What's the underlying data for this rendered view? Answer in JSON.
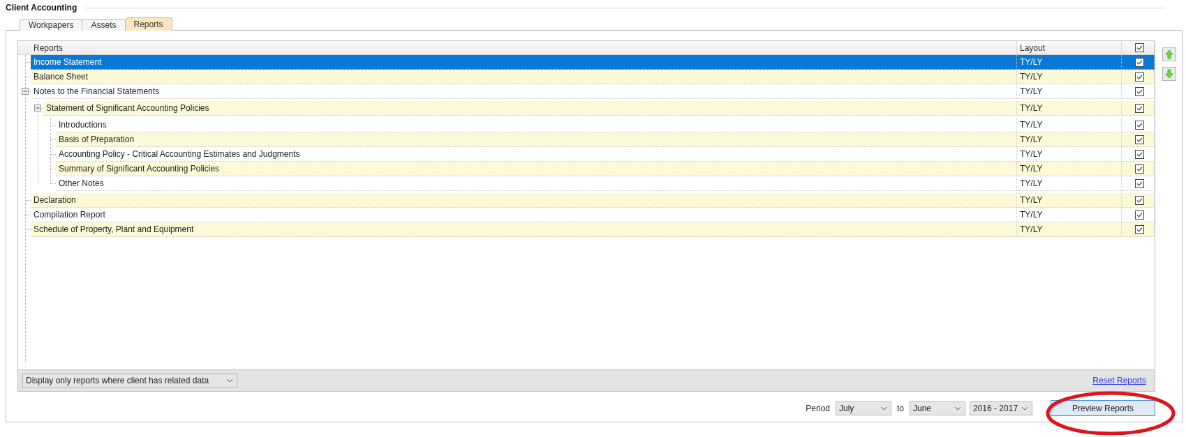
{
  "window": {
    "title": "Client Accounting"
  },
  "tabs": [
    {
      "label": "Workpapers",
      "selected": false
    },
    {
      "label": "Assets",
      "selected": false
    },
    {
      "label": "Reports",
      "selected": true
    }
  ],
  "grid": {
    "columns": [
      "Reports",
      "Layout"
    ],
    "header_checked": true,
    "rows": [
      {
        "label": "Income Statement",
        "layout": "TY/LY",
        "checked": true,
        "selected": true
      },
      {
        "label": "Balance Sheet",
        "layout": "TY/LY",
        "checked": true,
        "selected": false
      },
      {
        "label": "Notes to the Financial Statements",
        "layout": "TY/LY",
        "checked": true,
        "selected": false,
        "expanded": true,
        "children": [
          {
            "label": "Statement of Significant Accounting Policies",
            "layout": "TY/LY",
            "checked": true,
            "selected": false,
            "expanded": true,
            "children": [
              {
                "label": "Introductions",
                "layout": "TY/LY",
                "checked": true,
                "selected": false
              },
              {
                "label": "Basis of Preparation",
                "layout": "TY/LY",
                "checked": true,
                "selected": false
              },
              {
                "label": "Accounting Policy - Critical Accounting Estimates and Judgments",
                "layout": "TY/LY",
                "checked": true,
                "selected": false
              },
              {
                "label": "Summary of Significant Accounting Policies",
                "layout": "TY/LY",
                "checked": true,
                "selected": false
              },
              {
                "label": "Other Notes",
                "layout": "TY/LY",
                "checked": true,
                "selected": false
              }
            ]
          }
        ]
      },
      {
        "label": "Declaration",
        "layout": "TY/LY",
        "checked": true,
        "selected": false
      },
      {
        "label": "Compilation Report",
        "layout": "TY/LY",
        "checked": true,
        "selected": false
      },
      {
        "label": "Schedule of Property, Plant and Equipment",
        "layout": "TY/LY",
        "checked": true,
        "selected": false
      }
    ]
  },
  "filter": {
    "value": "Display only reports where client has related data"
  },
  "reset_link": "Reset Reports",
  "period": {
    "label": "Period",
    "from": "July",
    "to_label": "to",
    "to": "June",
    "year": "2016 - 2017"
  },
  "preview_button": "Preview Reports"
}
